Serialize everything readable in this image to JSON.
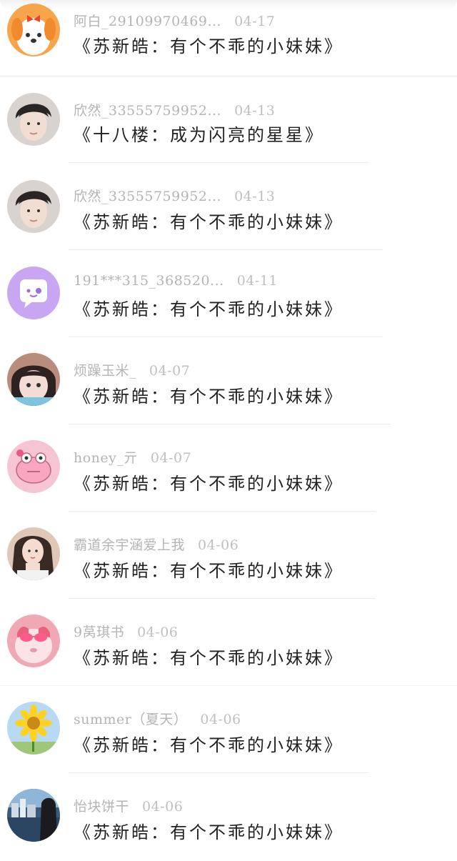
{
  "items": [
    {
      "user": "阿白_29109970469...",
      "date": "04-17",
      "title": "《苏新皓：有个不乖的小妹妹》",
      "avatar_icon": "cartoon-dog-avatar",
      "bg": "#f6a54a"
    },
    {
      "user": "欣然_33555759952...",
      "date": "04-13",
      "title": "《十八楼：成为闪亮的星星》",
      "avatar_icon": "young-man-avatar",
      "bg": "#d9d3cf"
    },
    {
      "user": "欣然_33555759952...",
      "date": "04-13",
      "title": "《苏新皓：有个不乖的小妹妹》",
      "avatar_icon": "young-man-avatar",
      "bg": "#d9d3cf"
    },
    {
      "user": "191***315_368520...",
      "date": "04-11",
      "title": "《苏新皓：有个不乖的小妹妹》",
      "avatar_icon": "chat-bubble-avatar",
      "bg": "#c9a6f2"
    },
    {
      "user": "烦躁玉米_",
      "date": "04-07",
      "title": "《苏新皓：有个不乖的小妹妹》",
      "avatar_icon": "child-face-avatar",
      "bg": "#b98d7d"
    },
    {
      "user": "honey_亓",
      "date": "04-07",
      "title": "《苏新皓：有个不乖的小妹妹》",
      "avatar_icon": "pink-frog-avatar",
      "bg": "#f5c5d3"
    },
    {
      "user": "霸道余宇涵爱上我",
      "date": "04-06",
      "title": "《苏新皓：有个不乖的小妹妹》",
      "avatar_icon": "girl-photo-avatar",
      "bg": "#e0c8b8"
    },
    {
      "user": "9莴琪书",
      "date": "04-06",
      "title": "《苏新皓：有个不乖的小妹妹》",
      "avatar_icon": "pink-toy-sunglasses-avatar",
      "bg": "#f0a9b4"
    },
    {
      "user": "summer（夏天）",
      "date": "04-06",
      "title": "《苏新皓：有个不乖的小妹妹》",
      "avatar_icon": "sunflower-avatar",
      "bg": "#b8d9f2"
    },
    {
      "user": "怡块饼干",
      "date": "04-06",
      "title": "《苏新皓：有个不乖的小妹妹》",
      "avatar_icon": "city-night-avatar",
      "bg": "#3a5c7a"
    }
  ]
}
